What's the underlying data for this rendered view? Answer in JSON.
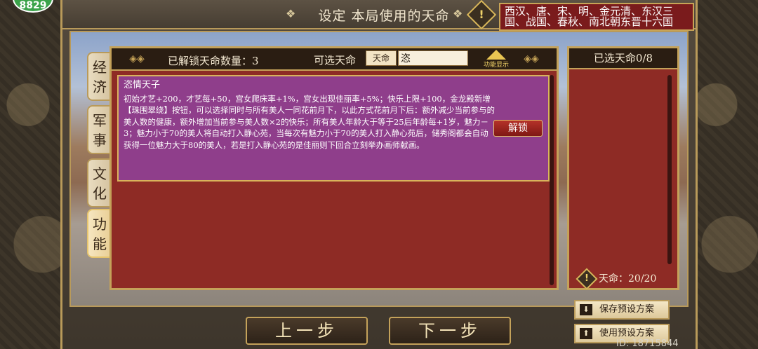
{
  "badge": {
    "text": "8829"
  },
  "header": {
    "title": "设定 本局使用的天命",
    "dynasties": "西汉、唐、宋、明、金元清、东汉三国、战国、春秋、南北朝东晋十六国"
  },
  "tabs": [
    {
      "label": "经济"
    },
    {
      "label": "军事"
    },
    {
      "label": "文化"
    },
    {
      "label": "功能"
    }
  ],
  "panel": {
    "unlocked_label": "已解锁天命数量：3",
    "choose_label": "可选天命",
    "search_tag": "天命",
    "search_value": "恣",
    "func_label": "功能显示"
  },
  "card": {
    "title": "恣情天子",
    "description": "初始才艺+200，才艺每+50，宫女爬床率+1%，宫女出现佳丽率+5%；快乐上限+100，金龙殿新增【珠围翠绕】按钮，可以选择同时与所有美人一同花前月下，以此方式花前月下后：额外减少当前参与的美人数的健康，额外增加当前参与美人数×2的快乐；所有美人年龄大于等于25后年龄每+1岁，魅力－3；魅力小于70的美人将自动打入静心苑，当每次有魅力小于70的美人打入静心苑后，储秀阁都会自动获得一位魅力大于80的美人，若是打入静心苑的是佳丽则下回合立刻举办画师献画。",
    "unlock_label": "解锁"
  },
  "right_panel": {
    "title": "已选天命0/8",
    "count_label": "天命：20/20"
  },
  "nav": {
    "prev_label": "上一步",
    "next_label": "下一步"
  },
  "presets": {
    "save_label": "保存预设方案",
    "use_label": "使用预设方案"
  },
  "player": {
    "id_text": "ID: 18715844"
  },
  "colors": {
    "panel_red": "#8e2b25",
    "card_purple": "#8f3e8b",
    "gold_border": "#c4a25a",
    "dynasty_red": "#7a1b1c"
  }
}
